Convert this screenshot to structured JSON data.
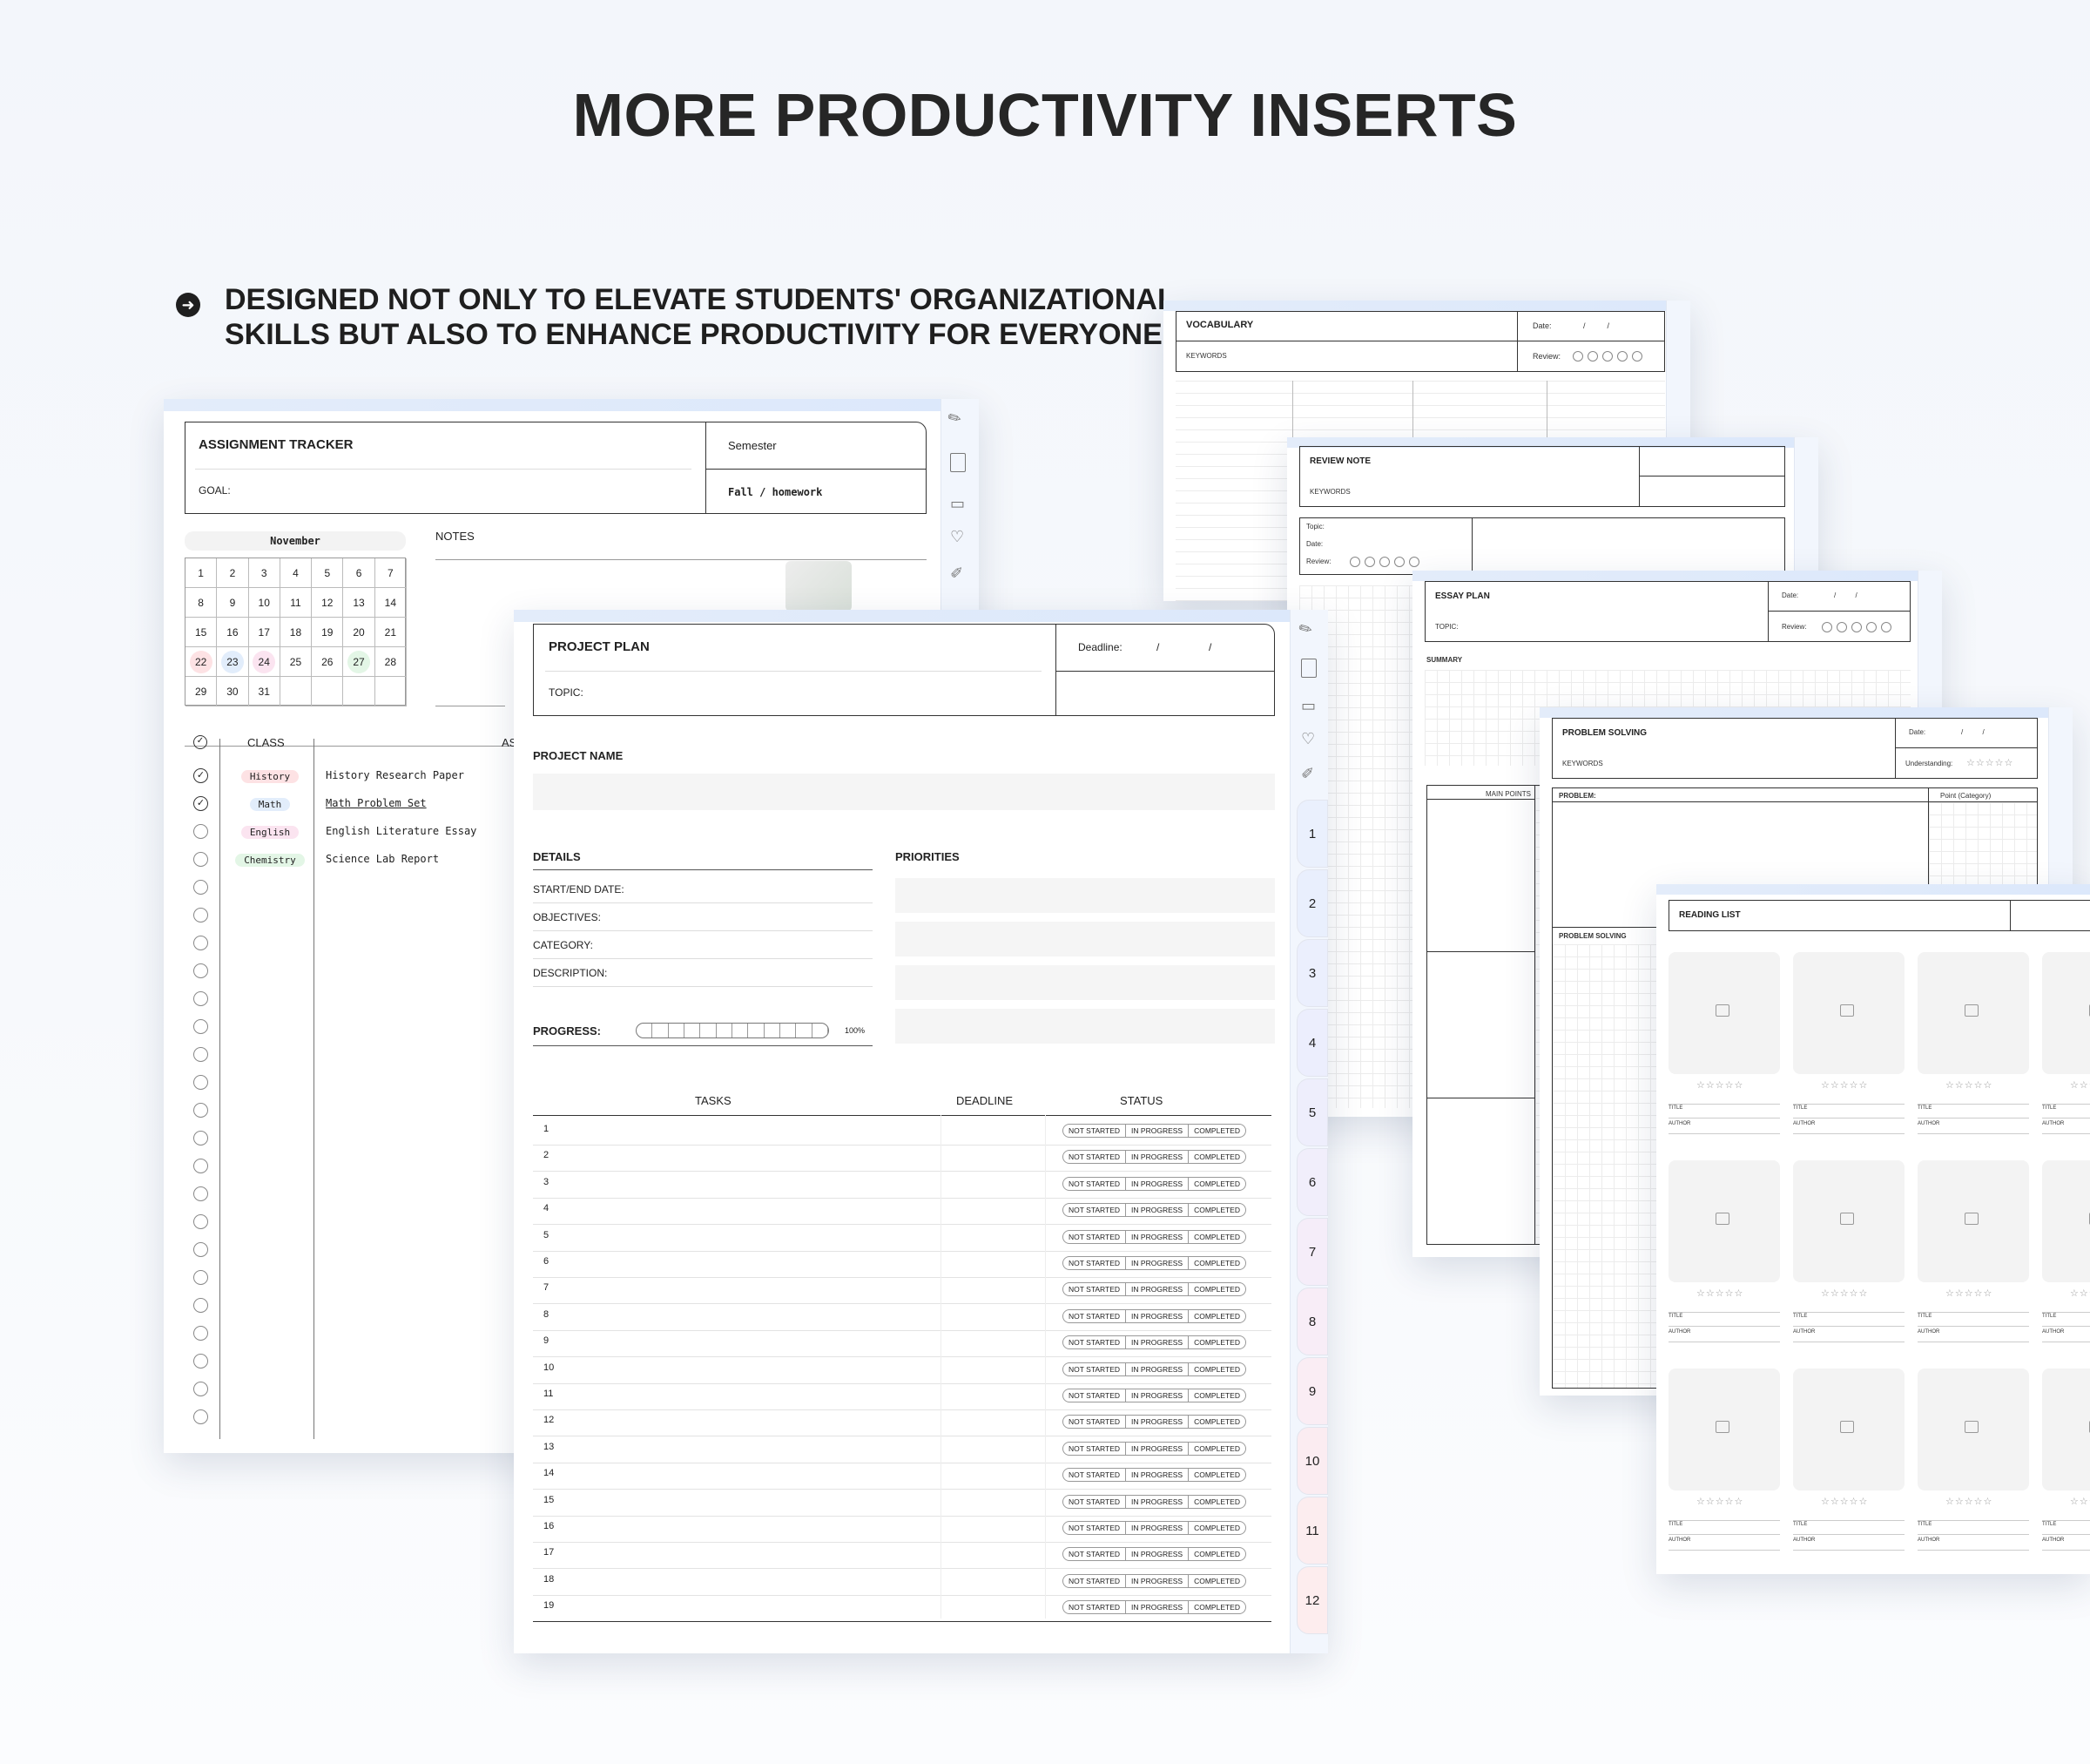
{
  "headline": "MORE PRODUCTIVITY INSERTS",
  "subline": {
    "line1": "DESIGNED NOT ONLY TO ELEVATE STUDENTS' ORGANIZATIONAL",
    "line2": "SKILLS BUT ALSO TO ENHANCE PRODUCTIVITY FOR EVERYONE!"
  },
  "assignment": {
    "title": "ASSIGNMENT TRACKER",
    "semester_label": "Semester",
    "goal_label": "GOAL:",
    "semester_value": "Fall / homework",
    "month": "November",
    "days": [
      "1",
      "2",
      "3",
      "4",
      "5",
      "6",
      "7",
      "8",
      "9",
      "10",
      "11",
      "12",
      "13",
      "14",
      "15",
      "16",
      "17",
      "18",
      "19",
      "20",
      "21",
      "22",
      "23",
      "24",
      "25",
      "26",
      "27",
      "28",
      "29",
      "30",
      "31"
    ],
    "notes_label": "NOTES",
    "class_header": "CLASS",
    "assignment_header_fragment": "AS",
    "rows": [
      {
        "class": "History",
        "assignment": "History Research Paper",
        "done": true,
        "color": "#fde2e4"
      },
      {
        "class": "Math",
        "assignment": "Math Problem Set",
        "done": true,
        "color": "#e2edfb"
      },
      {
        "class": "English",
        "assignment": "English Literature Essay",
        "done": false,
        "color": "#fbe4f0"
      },
      {
        "class": "Chemistry",
        "assignment": "Science Lab Report",
        "done": false,
        "color": "#e3f6e6"
      }
    ]
  },
  "project": {
    "title": "PROJECT PLAN",
    "deadline_label": "Deadline:",
    "topic_label": "TOPIC:",
    "name_label": "PROJECT NAME",
    "details_label": "DETAILS",
    "priorities_label": "PRIORITIES",
    "fields": [
      "START/END DATE:",
      "OBJECTIVES:",
      "CATEGORY:",
      "DESCRIPTION:"
    ],
    "progress_label": "PROGRESS:",
    "progress_pct": "100%",
    "tasks_header": "TASKS",
    "deadline_header": "DEADLINE",
    "status_header": "STATUS",
    "status_options": [
      "NOT STARTED",
      "IN PROGRESS",
      "COMPLETED"
    ],
    "task_numbers": [
      "1",
      "2",
      "3",
      "4",
      "5",
      "6",
      "7",
      "8",
      "9",
      "10",
      "11",
      "12",
      "13",
      "14",
      "15",
      "16",
      "17",
      "18",
      "19"
    ],
    "tabs": [
      "1",
      "2",
      "3",
      "4",
      "5",
      "6",
      "7",
      "8",
      "9",
      "10",
      "11",
      "12"
    ]
  },
  "vocabulary": {
    "title": "VOCABULARY",
    "date_label": "Date:",
    "keywords_label": "KEYWORDS",
    "review_label": "Review:"
  },
  "review_note": {
    "title": "REVIEW NOTE",
    "keywords_label": "KEYWORDS",
    "topic_label": "Topic:",
    "date_label": "Date:",
    "review_label": "Review:"
  },
  "essay": {
    "title": "ESSAY PLAN",
    "date_label": "Date:",
    "topic_label": "TOPIC:",
    "review_label": "Review:",
    "summary_label": "SUMMARY",
    "main_points_label": "MAIN POINTS"
  },
  "problem": {
    "title": "PROBLEM SOLVING",
    "date_label": "Date:",
    "keywords_label": "KEYWORDS",
    "understanding_label": "Understanding:",
    "problem_label": "PROBLEM:",
    "point_label": "Point (Category)",
    "solving_label": "PROBLEM SOLVING"
  },
  "reading": {
    "title": "READING LIST",
    "title_label": "TITLE",
    "author_label": "AUTHOR"
  }
}
